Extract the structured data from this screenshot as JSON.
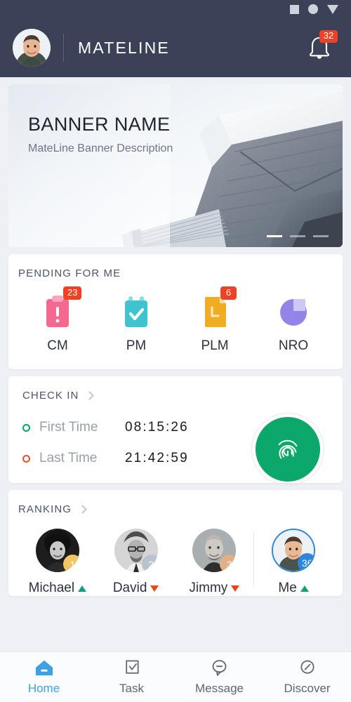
{
  "statusbar": {
    "icons": [
      "square-icon",
      "circle-icon",
      "triangle-down-icon"
    ]
  },
  "header": {
    "title": "MATELINE",
    "avatar_name": "user-avatar",
    "notification_count": "32",
    "bell_icon": "bell-icon"
  },
  "banner": {
    "title": "BANNER NAME",
    "subtitle": "MateLine Banner Description",
    "image_alt": "modern-architecture-photo",
    "carousel": {
      "total": 3,
      "active_index": 0
    }
  },
  "pending": {
    "heading": "PENDING FOR ME",
    "items": [
      {
        "label": "CM",
        "badge": "23",
        "icon": "clipboard-alert-icon",
        "color": "#F56991"
      },
      {
        "label": "PM",
        "badge": "",
        "icon": "calendar-check-icon",
        "color": "#3EC4CE"
      },
      {
        "label": "PLM",
        "badge": "6",
        "icon": "document-l-icon",
        "color": "#F0AD22"
      },
      {
        "label": "NRO",
        "badge": "",
        "icon": "pie-chart-icon",
        "color": "#9385E8"
      }
    ]
  },
  "checkin": {
    "heading": "CHECK IN",
    "chevron_icon": "chevron-right-icon",
    "rows": [
      {
        "label": "First Time",
        "time": "08:15:26",
        "dot_color": "#00A860"
      },
      {
        "label": "Last Time",
        "time": "21:42:59",
        "dot_color": "#E8502A"
      }
    ],
    "fingerprint": {
      "icon": "fingerprint-icon",
      "button_color": "#0CA86A"
    }
  },
  "ranking": {
    "heading": "RANKING",
    "chevron_icon": "chevron-right-icon",
    "items": [
      {
        "name": "Michael",
        "badge": "1",
        "badge_color": "#F3C665",
        "trend": "up",
        "is_me": false
      },
      {
        "name": "David",
        "badge": "2",
        "badge_color": "#B7C4CE",
        "trend": "down",
        "is_me": false
      },
      {
        "name": "Jimmy",
        "badge": "3",
        "badge_color": "#E0B08A",
        "trend": "down",
        "is_me": false
      }
    ],
    "me": {
      "name": "Me",
      "badge": "36",
      "badge_color": "#2E86D8",
      "trend": "up",
      "is_me": true
    }
  },
  "tabbar": {
    "tabs": [
      {
        "label": "Home",
        "icon": "home-icon",
        "active": true
      },
      {
        "label": "Task",
        "icon": "task-check-icon",
        "active": false
      },
      {
        "label": "Message",
        "icon": "message-icon",
        "active": false
      },
      {
        "label": "Discover",
        "icon": "compass-icon",
        "active": false
      }
    ]
  },
  "colors": {
    "header_bg": "#3B4257",
    "page_bg": "#EEF0F5",
    "accent_red": "#EF4123",
    "accent_blue": "#3EA0E0",
    "accent_green": "#0CA86A"
  }
}
